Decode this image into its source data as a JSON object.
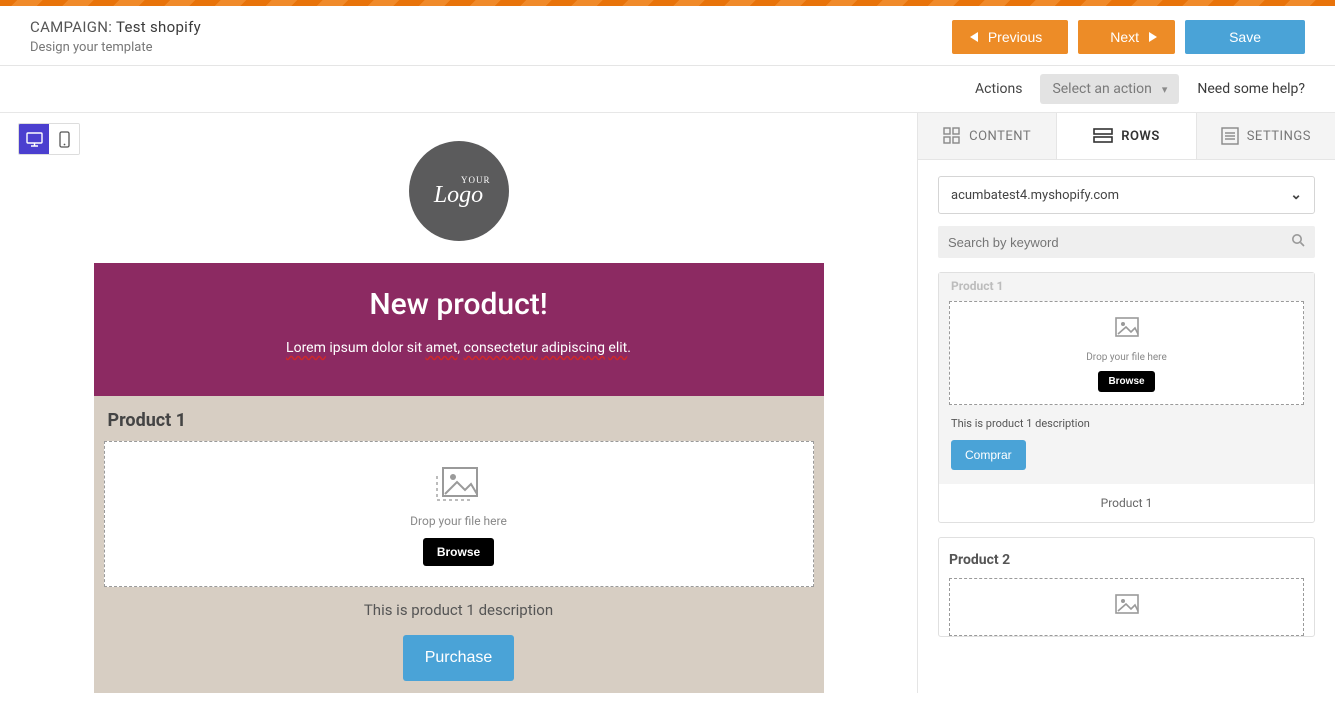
{
  "colors": {
    "orange": "#ed8c27",
    "blue": "#4aa3d7",
    "purple": "#8c2a62",
    "toggle": "#4b3fcf"
  },
  "header": {
    "campaign_label": "CAMPAIGN:",
    "campaign_name": "Test shopify",
    "subtitle": "Design your template",
    "prev": "Previous",
    "next": "Next",
    "save": "Save"
  },
  "toolbar": {
    "actions_label": "Actions",
    "select_placeholder": "Select an action",
    "help": "Need some help?"
  },
  "canvas": {
    "logo_top": "YOUR",
    "logo_main": "Logo",
    "hero_title": "New product!",
    "hero_text_parts": [
      "Lorem",
      " ipsum dolor sit ",
      "amet",
      ", ",
      "consectetur",
      " ",
      "adipiscing",
      " ",
      "elit",
      "."
    ],
    "product_title": "Product 1",
    "drop_text": "Drop your file here",
    "browse": "Browse",
    "description": "This is product 1 description",
    "purchase": "Purchase"
  },
  "sidebar": {
    "tabs": {
      "content": "CONTENT",
      "rows": "ROWS",
      "settings": "SETTINGS"
    },
    "active_tab": "rows",
    "store": "acumbatest4.myshopify.com",
    "search_placeholder": "Search by keyword",
    "rows": [
      {
        "cut_title": "Product 1",
        "drop_text": "Drop your file here",
        "browse": "Browse",
        "desc": "This is product 1 description",
        "buy": "Comprar",
        "footer": "Product 1"
      },
      {
        "title": "Product 2"
      }
    ]
  }
}
